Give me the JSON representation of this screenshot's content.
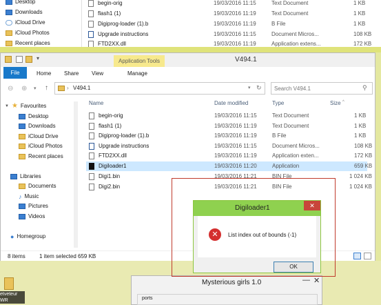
{
  "bg_window": {
    "nav": [
      "Desktop",
      "Downloads",
      "iCloud Drive",
      "iCloud Photos",
      "Recent places"
    ],
    "files": [
      {
        "name": "begin-orig",
        "date": "19/03/2016 11:15",
        "type": "Text Document",
        "size": "1 KB"
      },
      {
        "name": "flash1 (1)",
        "date": "19/03/2016 11:19",
        "type": "Text Document",
        "size": "1 KB"
      },
      {
        "name": "Digiprog-loader (1).b",
        "date": "19/03/2016 11:19",
        "type": "B File",
        "size": "1 KB"
      },
      {
        "name": "Upgrade instructions",
        "date": "19/03/2016 11:15",
        "type": "Document Micros...",
        "size": "108 KB"
      },
      {
        "name": "FTD2XX.dll",
        "date": "19/03/2016 11:19",
        "type": "Application extens...",
        "size": "172 KB"
      }
    ]
  },
  "window": {
    "title": "V494.1",
    "context_tab": "Application Tools",
    "tabs": {
      "file": "File",
      "home": "Home",
      "share": "Share",
      "view": "View",
      "manage": "Manage"
    },
    "address": "V494.1",
    "search_placeholder": "Search V494.1",
    "columns": {
      "name": "Name",
      "date": "Date modified",
      "type": "Type",
      "size": "Size"
    },
    "nav": {
      "favourites": "Favourites",
      "fav_items": [
        "Desktop",
        "Downloads",
        "iCloud Drive",
        "iCloud Photos",
        "Recent places"
      ],
      "libraries": "Libraries",
      "lib_items": [
        "Documents",
        "Music",
        "Pictures",
        "Videos"
      ],
      "homegroup": "Homegroup"
    },
    "files": [
      {
        "name": "begin-orig",
        "date": "19/03/2016 11:15",
        "type": "Text Document",
        "size": "1 KB"
      },
      {
        "name": "flash1 (1)",
        "date": "19/03/2016 11:19",
        "type": "Text Document",
        "size": "1 KB"
      },
      {
        "name": "Digiprog-loader (1).b",
        "date": "19/03/2016 11:19",
        "type": "B File",
        "size": "1 KB"
      },
      {
        "name": "Upgrade instructions",
        "date": "19/03/2016 11:15",
        "type": "Document Micros...",
        "size": "108 KB"
      },
      {
        "name": "FTD2XX.dll",
        "date": "19/03/2016 11:19",
        "type": "Application exten...",
        "size": "172 KB"
      },
      {
        "name": "Digiloader1",
        "date": "19/03/2016 11:20",
        "type": "Application",
        "size": "659 KB"
      },
      {
        "name": "Digi1.bin",
        "date": "19/03/2016 11:21",
        "type": "BIN File",
        "size": "1 024 KB"
      },
      {
        "name": "Digi2.bin",
        "date": "19/03/2016 11:21",
        "type": "BIN File",
        "size": "1 024 KB"
      }
    ],
    "status": {
      "count": "8 items",
      "selection": "1 item selected  659 KB"
    }
  },
  "dialog": {
    "title": "Digiloader1",
    "close": "✕",
    "message": "List index out of bounds (-1)",
    "ok": "OK"
  },
  "desktop": {
    "icon_label": "etveteur WR",
    "window_title": "Mysterious girls 1.0",
    "group_label": "ports",
    "controls": [
      "—",
      "✕"
    ]
  },
  "colors": {
    "accent": "#1979ca",
    "context_tab": "#f7e98d",
    "dialog_title": "#8fd14f",
    "alert": "#c0392b"
  }
}
